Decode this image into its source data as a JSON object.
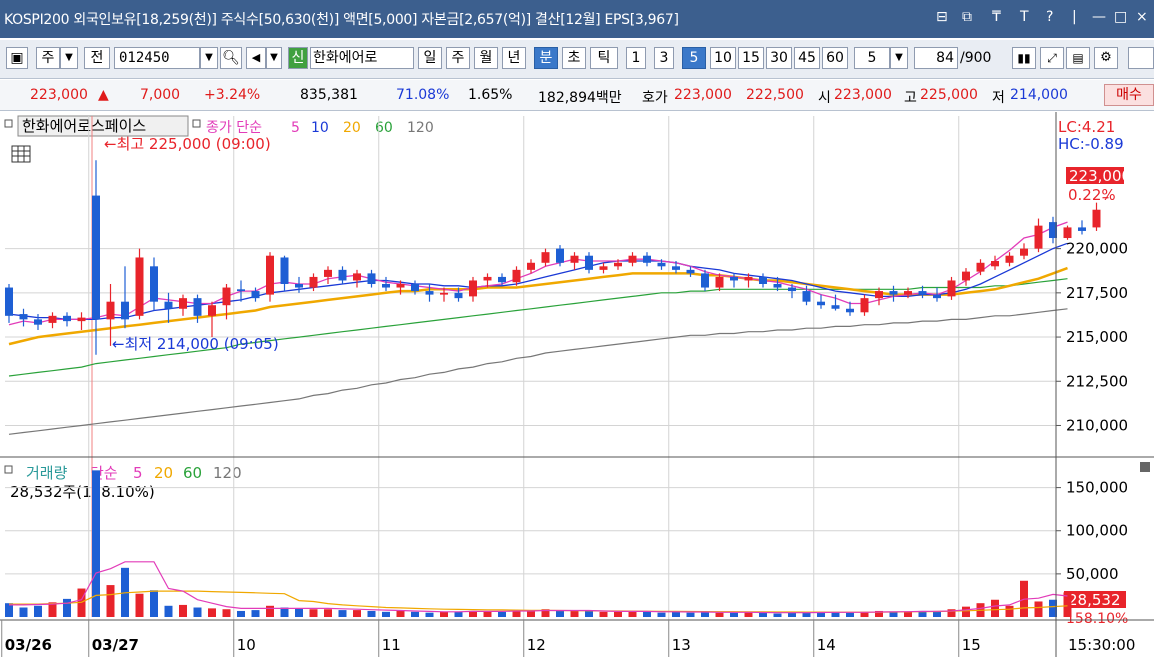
{
  "title_bar": {
    "text": "KOSPI200 외국인보유[18,259(천)] 주식수[50,630(천)] 액면[5,000] 자본금[2,657(억)] 결산[12월] EPS[3,967]",
    "controls": [
      "⊟",
      "⧉",
      "₸",
      "T",
      "?",
      "|",
      "—",
      "□",
      "×"
    ]
  },
  "toolbar": {
    "type_btn": "주",
    "prev_btn": "전",
    "code": "012450",
    "name": "한화에어로",
    "name_badge": "신",
    "periods": [
      "일",
      "주",
      "월",
      "년",
      "분",
      "초",
      "틱"
    ],
    "active_period": "분",
    "intervals": [
      "1",
      "3",
      "5",
      "10",
      "15",
      "30",
      "45",
      "60"
    ],
    "active_interval": "5",
    "unit_value": "5",
    "count_value": "84",
    "count_max": "/900"
  },
  "info_bar": {
    "price": "223,000",
    "arrow": "▲",
    "change": "7,000",
    "change_pct": "+3.24%",
    "volume": "835,381",
    "vol_ratio": "71.08%",
    "turnover": "1.65%",
    "amount": "182,894백만",
    "ask_label": "호가",
    "ask1": "223,000",
    "ask2": "222,500",
    "open_label": "시",
    "open": "223,000",
    "high_label": "고",
    "high": "225,000",
    "low_label": "저",
    "low": "214,000",
    "buy_btn": "매수"
  },
  "price_panel": {
    "title": "한화에어로스페이스",
    "legend_prefix": "종가 단순",
    "legend_ma": [
      "5",
      "10",
      "20",
      "60",
      "120"
    ],
    "high_note": "←최고 225,000 (09:00)",
    "low_note": "←최저 214,000 (09:05)",
    "lc": "LC:4.21",
    "hc": "HC:-0.89",
    "last_price_tag": "223,000",
    "last_pct_tag": "0.22%"
  },
  "volume_panel": {
    "title": "거래량",
    "legend_prefix": "단순",
    "legend_ma": [
      "5",
      "20",
      "60",
      "120"
    ],
    "last_value": "28,532주(158.10%)",
    "last_tag": "28,532",
    "last_pct_tag": "158.10%"
  },
  "chart_data": {
    "type": "candlestick",
    "colors": {
      "up": "#e8242b",
      "down": "#1e5fd4",
      "ma5": "#e23cb9",
      "ma10": "#1a39d6",
      "ma20": "#f0a800",
      "ma60": "#2aa23a",
      "ma120": "#777777"
    },
    "price_axis": {
      "ylim": [
        208500,
        227500
      ],
      "ticks": [
        "220,000",
        "217,500",
        "215,000",
        "212,500",
        "210,000"
      ],
      "tick_values": [
        220000,
        217500,
        215000,
        212500,
        210000
      ]
    },
    "volume_axis": {
      "ylim": [
        0,
        182000
      ],
      "ticks": [
        "150,000",
        "100,000",
        "50,000"
      ],
      "tick_values": [
        150000,
        100000,
        50000
      ]
    },
    "x_labels": [
      {
        "i": 0,
        "label": "03/26",
        "bold": true
      },
      {
        "i": 6,
        "label": "03/27",
        "bold": true
      },
      {
        "i": 16,
        "label": "10"
      },
      {
        "i": 26,
        "label": "11"
      },
      {
        "i": 36,
        "label": "12"
      },
      {
        "i": 46,
        "label": "13"
      },
      {
        "i": 56,
        "label": "14"
      },
      {
        "i": 66,
        "label": "15"
      }
    ],
    "time_label": "15:30:00",
    "candles": [
      [
        217800,
        218000,
        215800,
        216200
      ],
      [
        216300,
        216600,
        215600,
        216000
      ],
      [
        216000,
        216300,
        215400,
        215700
      ],
      [
        215800,
        216400,
        215500,
        216200
      ],
      [
        216200,
        216400,
        215600,
        215900
      ],
      [
        215900,
        216400,
        215400,
        216100
      ],
      [
        223000,
        225000,
        214000,
        216000
      ],
      [
        216000,
        218000,
        214500,
        217000
      ],
      [
        217000,
        219000,
        215500,
        216000
      ],
      [
        216200,
        220000,
        216000,
        219500
      ],
      [
        219000,
        219500,
        216500,
        217000
      ],
      [
        217000,
        217500,
        215800,
        216600
      ],
      [
        216600,
        217400,
        216200,
        217200
      ],
      [
        217200,
        217400,
        215800,
        216200
      ],
      [
        216200,
        217000,
        215000,
        216800
      ],
      [
        216800,
        218000,
        216000,
        217800
      ],
      [
        217700,
        218200,
        217000,
        217600
      ],
      [
        217600,
        217800,
        217000,
        217200
      ],
      [
        217400,
        219800,
        217000,
        219600
      ],
      [
        219500,
        219600,
        217600,
        218000
      ],
      [
        218000,
        218400,
        217500,
        217800
      ],
      [
        217800,
        218600,
        217600,
        218400
      ],
      [
        218400,
        219000,
        218000,
        218800
      ],
      [
        218800,
        219000,
        218000,
        218200
      ],
      [
        218200,
        218800,
        217800,
        218600
      ],
      [
        218600,
        218800,
        217800,
        218000
      ],
      [
        218000,
        218400,
        217600,
        217800
      ],
      [
        217800,
        218200,
        217400,
        218000
      ],
      [
        218000,
        218200,
        217400,
        217600
      ],
      [
        217600,
        218000,
        217000,
        217400
      ],
      [
        217400,
        217800,
        217000,
        217500
      ],
      [
        217500,
        217800,
        217000,
        217200
      ],
      [
        217300,
        218400,
        217000,
        218200
      ],
      [
        218200,
        218600,
        217800,
        218400
      ],
      [
        218400,
        218600,
        217900,
        218100
      ],
      [
        218100,
        219000,
        217900,
        218800
      ],
      [
        218800,
        219400,
        218600,
        219200
      ],
      [
        219200,
        220000,
        219000,
        219800
      ],
      [
        220000,
        220200,
        219000,
        219200
      ],
      [
        219200,
        219800,
        218800,
        219600
      ],
      [
        219600,
        219800,
        218600,
        218800
      ],
      [
        218800,
        219200,
        218600,
        219000
      ],
      [
        219000,
        219400,
        218800,
        219200
      ],
      [
        219200,
        219800,
        219000,
        219600
      ],
      [
        219600,
        219800,
        219000,
        219200
      ],
      [
        219200,
        219400,
        218800,
        219000
      ],
      [
        219000,
        219300,
        218600,
        218800
      ],
      [
        218800,
        219000,
        218400,
        218600
      ],
      [
        218600,
        218800,
        217600,
        217800
      ],
      [
        217800,
        218600,
        217600,
        218400
      ],
      [
        218400,
        218600,
        217800,
        218200
      ],
      [
        218200,
        218600,
        217800,
        218400
      ],
      [
        218400,
        218600,
        217800,
        218000
      ],
      [
        218000,
        218400,
        217600,
        217800
      ],
      [
        217800,
        218000,
        217200,
        217600
      ],
      [
        217600,
        217900,
        216800,
        217000
      ],
      [
        217000,
        217400,
        216600,
        216800
      ],
      [
        216800,
        217400,
        216500,
        216600
      ],
      [
        216600,
        217000,
        216200,
        216400
      ],
      [
        216400,
        217400,
        216200,
        217200
      ],
      [
        217200,
        217800,
        216800,
        217600
      ],
      [
        217600,
        217900,
        217000,
        217400
      ],
      [
        217400,
        217800,
        217200,
        217600
      ],
      [
        217600,
        217900,
        217200,
        217400
      ],
      [
        217400,
        217800,
        217000,
        217200
      ],
      [
        217300,
        218400,
        217100,
        218200
      ],
      [
        218200,
        218900,
        217900,
        218700
      ],
      [
        218700,
        219400,
        218500,
        219200
      ],
      [
        219000,
        219600,
        218800,
        219300
      ],
      [
        219200,
        219800,
        219000,
        219600
      ],
      [
        219600,
        220300,
        219400,
        220000
      ],
      [
        220000,
        221700,
        219800,
        221300
      ],
      [
        221500,
        221800,
        220300,
        220600
      ],
      [
        220600,
        221300,
        220500,
        221200
      ],
      [
        221200,
        221600,
        220800,
        221000
      ],
      [
        221200,
        222600,
        221000,
        222200
      ]
    ],
    "volumes": [
      16000,
      11000,
      13000,
      17000,
      21000,
      33000,
      170000,
      37000,
      57000,
      27000,
      31000,
      13000,
      14000,
      11000,
      10000,
      9000,
      7000,
      8000,
      13000,
      11000,
      10000,
      9000,
      9000,
      8000,
      8000,
      7000,
      6000,
      7000,
      6000,
      5000,
      6000,
      6000,
      7000,
      7000,
      6000,
      7000,
      8000,
      9000,
      8000,
      7000,
      7000,
      6000,
      6000,
      7000,
      6000,
      5000,
      6000,
      5000,
      6000,
      5000,
      5000,
      6000,
      5000,
      4000,
      5000,
      5000,
      6000,
      6000,
      5000,
      6000,
      7000,
      6000,
      6000,
      7000,
      7000,
      9000,
      12000,
      16000,
      20000,
      13000,
      42000,
      18000,
      20000,
      28532
    ],
    "ma_lines": {
      "ma5": [
        215700,
        215900,
        215800,
        216000,
        216000,
        216000,
        216100,
        216300,
        216200,
        216700,
        217200,
        217100,
        217000,
        216900,
        216900,
        217300,
        217600,
        217600,
        218000,
        218100,
        218000,
        218000,
        218300,
        218400,
        218500,
        218300,
        218100,
        218000,
        217900,
        217800,
        217700,
        217600,
        217800,
        217900,
        218000,
        218300,
        218600,
        219000,
        219200,
        219400,
        219300,
        219300,
        219300,
        219400,
        219400,
        219300,
        219200,
        219000,
        218700,
        218500,
        218400,
        218300,
        218200,
        218100,
        217900,
        217700,
        217400,
        217200,
        216900,
        216900,
        217100,
        217300,
        217400,
        217500,
        217400,
        217700,
        218200,
        218700,
        219300,
        219900,
        220600,
        220800,
        221200,
        221500
      ],
      "ma10": [
        216300,
        216200,
        216100,
        216100,
        216000,
        216000,
        216000,
        216100,
        216100,
        216300,
        216500,
        216600,
        216700,
        216800,
        216900,
        217000,
        217100,
        217300,
        217500,
        217600,
        217700,
        217800,
        217900,
        218000,
        218100,
        218200,
        218200,
        218100,
        218000,
        218000,
        217900,
        217900,
        217800,
        217900,
        217900,
        218000,
        218200,
        218400,
        218600,
        218800,
        219000,
        219200,
        219300,
        219300,
        219300,
        219300,
        219200,
        219000,
        218900,
        218800,
        218600,
        218500,
        218400,
        218300,
        218200,
        218000,
        217800,
        217600,
        217500,
        217400,
        217300,
        217300,
        217300,
        217400,
        217400,
        217500,
        217700,
        218000,
        218400,
        218800,
        219200,
        219600,
        220000,
        220300
      ],
      "ma20": [
        214600,
        214800,
        215000,
        215100,
        215200,
        215300,
        215400,
        215500,
        215600,
        215700,
        215800,
        215900,
        216000,
        216100,
        216200,
        216300,
        216400,
        216500,
        216700,
        216800,
        216900,
        217000,
        217100,
        217200,
        217300,
        217400,
        217500,
        217600,
        217600,
        217700,
        217700,
        217700,
        217700,
        217800,
        217800,
        217800,
        217900,
        218000,
        218100,
        218200,
        218300,
        218400,
        218500,
        218600,
        218600,
        218600,
        218600,
        218600,
        218500,
        218500,
        218400,
        218300,
        218200,
        218200,
        218100,
        218000,
        217900,
        217800,
        217700,
        217600,
        217500,
        217400,
        217400,
        217400,
        217400,
        217400,
        217500,
        217600,
        217700,
        217900,
        218100,
        218300,
        218600,
        218900
      ],
      "ma60": [
        212800,
        212900,
        213000,
        213100,
        213200,
        213300,
        213500,
        213600,
        213700,
        213800,
        213900,
        214000,
        214100,
        214200,
        214300,
        214400,
        214600,
        214700,
        214800,
        214900,
        215000,
        215100,
        215200,
        215300,
        215400,
        215500,
        215600,
        215700,
        215800,
        215900,
        216000,
        216100,
        216200,
        216300,
        216400,
        216500,
        216600,
        216700,
        216800,
        216900,
        217000,
        217100,
        217200,
        217300,
        217400,
        217500,
        217500,
        217600,
        217600,
        217700,
        217700,
        217700,
        217700,
        217700,
        217700,
        217700,
        217700,
        217700,
        217700,
        217700,
        217700,
        217700,
        217700,
        217800,
        217800,
        217800,
        217800,
        217800,
        217900,
        217900,
        218000,
        218100,
        218200,
        218300
      ],
      "ma120": [
        209500,
        209600,
        209700,
        209800,
        209900,
        210000,
        210100,
        210200,
        210300,
        210400,
        210500,
        210600,
        210700,
        210800,
        210900,
        211000,
        211100,
        211200,
        211300,
        211400,
        211500,
        211700,
        211800,
        212000,
        212100,
        212300,
        212400,
        212600,
        212700,
        212900,
        213000,
        213200,
        213300,
        213500,
        213600,
        213800,
        213900,
        214100,
        214200,
        214300,
        214400,
        214500,
        214600,
        214700,
        214800,
        214900,
        215000,
        215100,
        215100,
        215200,
        215200,
        215300,
        215300,
        215400,
        215400,
        215500,
        215500,
        215600,
        215600,
        215700,
        215700,
        215800,
        215800,
        215900,
        215900,
        216000,
        216000,
        216100,
        216200,
        216200,
        216300,
        216400,
        216500,
        216600
      ]
    },
    "volume_ma": {
      "ma5": [
        14000,
        14000,
        14500,
        15000,
        16000,
        20000,
        51000,
        56000,
        64000,
        64000,
        64000,
        33000,
        30000,
        20000,
        16000,
        12000,
        10000,
        10000,
        10000,
        10000,
        10000,
        10000,
        10000,
        9500,
        9000,
        8500,
        8000,
        7500,
        7000,
        6500,
        6000,
        6000,
        6500,
        6500,
        6500,
        7000,
        7000,
        7500,
        7500,
        7500,
        7500,
        7000,
        6500,
        6500,
        6500,
        6000,
        6000,
        5800,
        5800,
        5500,
        5400,
        5400,
        5200,
        5000,
        5000,
        5000,
        5200,
        5400,
        5400,
        5500,
        5800,
        6000,
        6200,
        6500,
        6600,
        7000,
        8200,
        10000,
        12800,
        14000,
        20600,
        21800,
        26200,
        24300
      ],
      "ma20": [
        15000,
        15000,
        15000,
        15500,
        16000,
        17000,
        25000,
        26000,
        28000,
        29000,
        30000,
        30000,
        30000,
        30000,
        29500,
        29000,
        28500,
        28000,
        27500,
        27000,
        19000,
        18000,
        15500,
        14000,
        13000,
        12000,
        11000,
        10500,
        10000,
        9500,
        9000,
        8800,
        8600,
        8400,
        8200,
        8000,
        7800,
        7600,
        7500,
        7400,
        7200,
        7000,
        6900,
        6800,
        6700,
        6600,
        6500,
        6400,
        6300,
        6200,
        6100,
        6000,
        5900,
        5800,
        5800,
        5700,
        5700,
        5600,
        5600,
        5600,
        5700,
        5800,
        6000,
        6200,
        6400,
        6800,
        7200,
        7800,
        8500,
        9000,
        10500,
        11000,
        12000,
        13000
      ]
    }
  }
}
